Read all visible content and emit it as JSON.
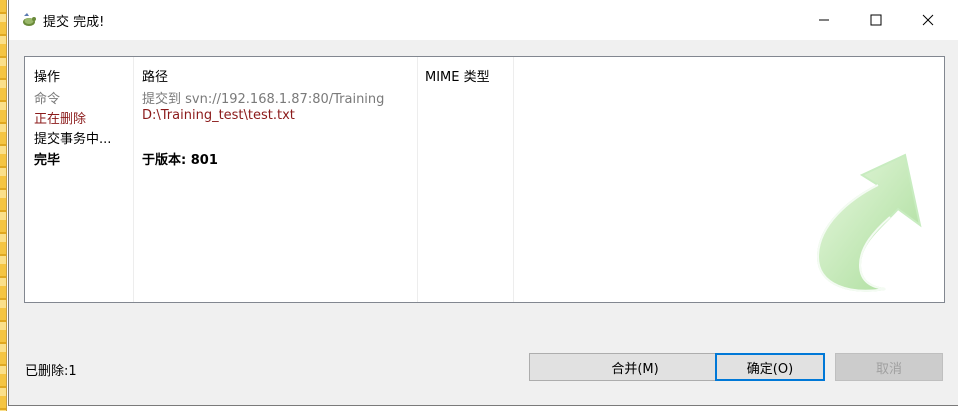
{
  "window": {
    "title": "提交 完成!"
  },
  "controls": {
    "minimize": "—",
    "maximize": "☐",
    "close": "✕"
  },
  "table": {
    "headers": [
      "操作",
      "路径",
      "MIME 类型"
    ],
    "rows": [
      {
        "action": "命令",
        "path": "提交到 svn://192.168.1.87:80/Training",
        "mime": "",
        "color": "#7a7a7a",
        "bold": false
      },
      {
        "action": "正在删除",
        "path": "D:\\Training_test\\test.txt",
        "mime": "",
        "color": "#8b1a1a",
        "bold": false
      },
      {
        "action": "提交事务中...",
        "path": "",
        "mime": "",
        "color": "#000000",
        "bold": false
      },
      {
        "action": "完毕",
        "path": "于版本: 801",
        "mime": "",
        "color": "#000000",
        "bold": true
      }
    ]
  },
  "status": {
    "text": "已删除:1"
  },
  "buttons": {
    "merge": "合并(M)",
    "ok": "确定(O)",
    "cancel": "取消"
  },
  "colors": {
    "accent": "#0078d7",
    "arrow_green": "#b8e6a8"
  }
}
